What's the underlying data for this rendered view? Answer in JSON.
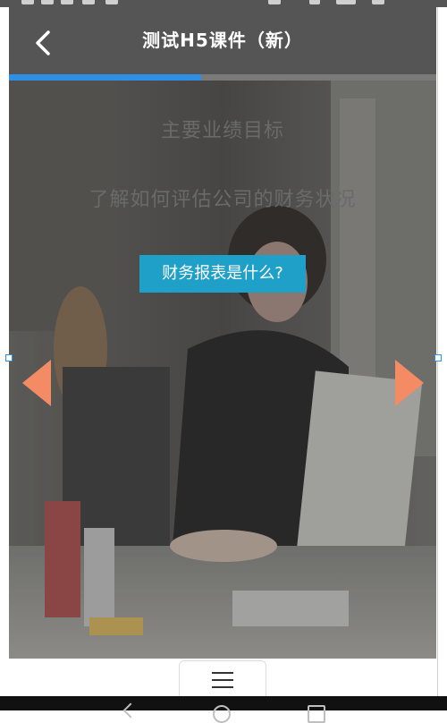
{
  "header": {
    "title": "测试H5课件（新）",
    "back_icon": "chevron-left-icon"
  },
  "progress": {
    "value_percent": 45,
    "color": "#2f8fe6"
  },
  "slide": {
    "heading1": "主要业绩目标",
    "heading2": "了解如何评估公司的财务状况",
    "cta_label": "财务报表是什么?",
    "cta_color": "#1fa0c8",
    "arrow_color": "#f58b64",
    "prev_icon": "triangle-left-icon",
    "next_icon": "triangle-right-icon"
  },
  "bottom": {
    "menu_icon": "hamburger-menu-icon"
  },
  "system_nav": {
    "icons": [
      "back-nav-icon",
      "home-nav-icon",
      "recents-nav-icon"
    ]
  }
}
